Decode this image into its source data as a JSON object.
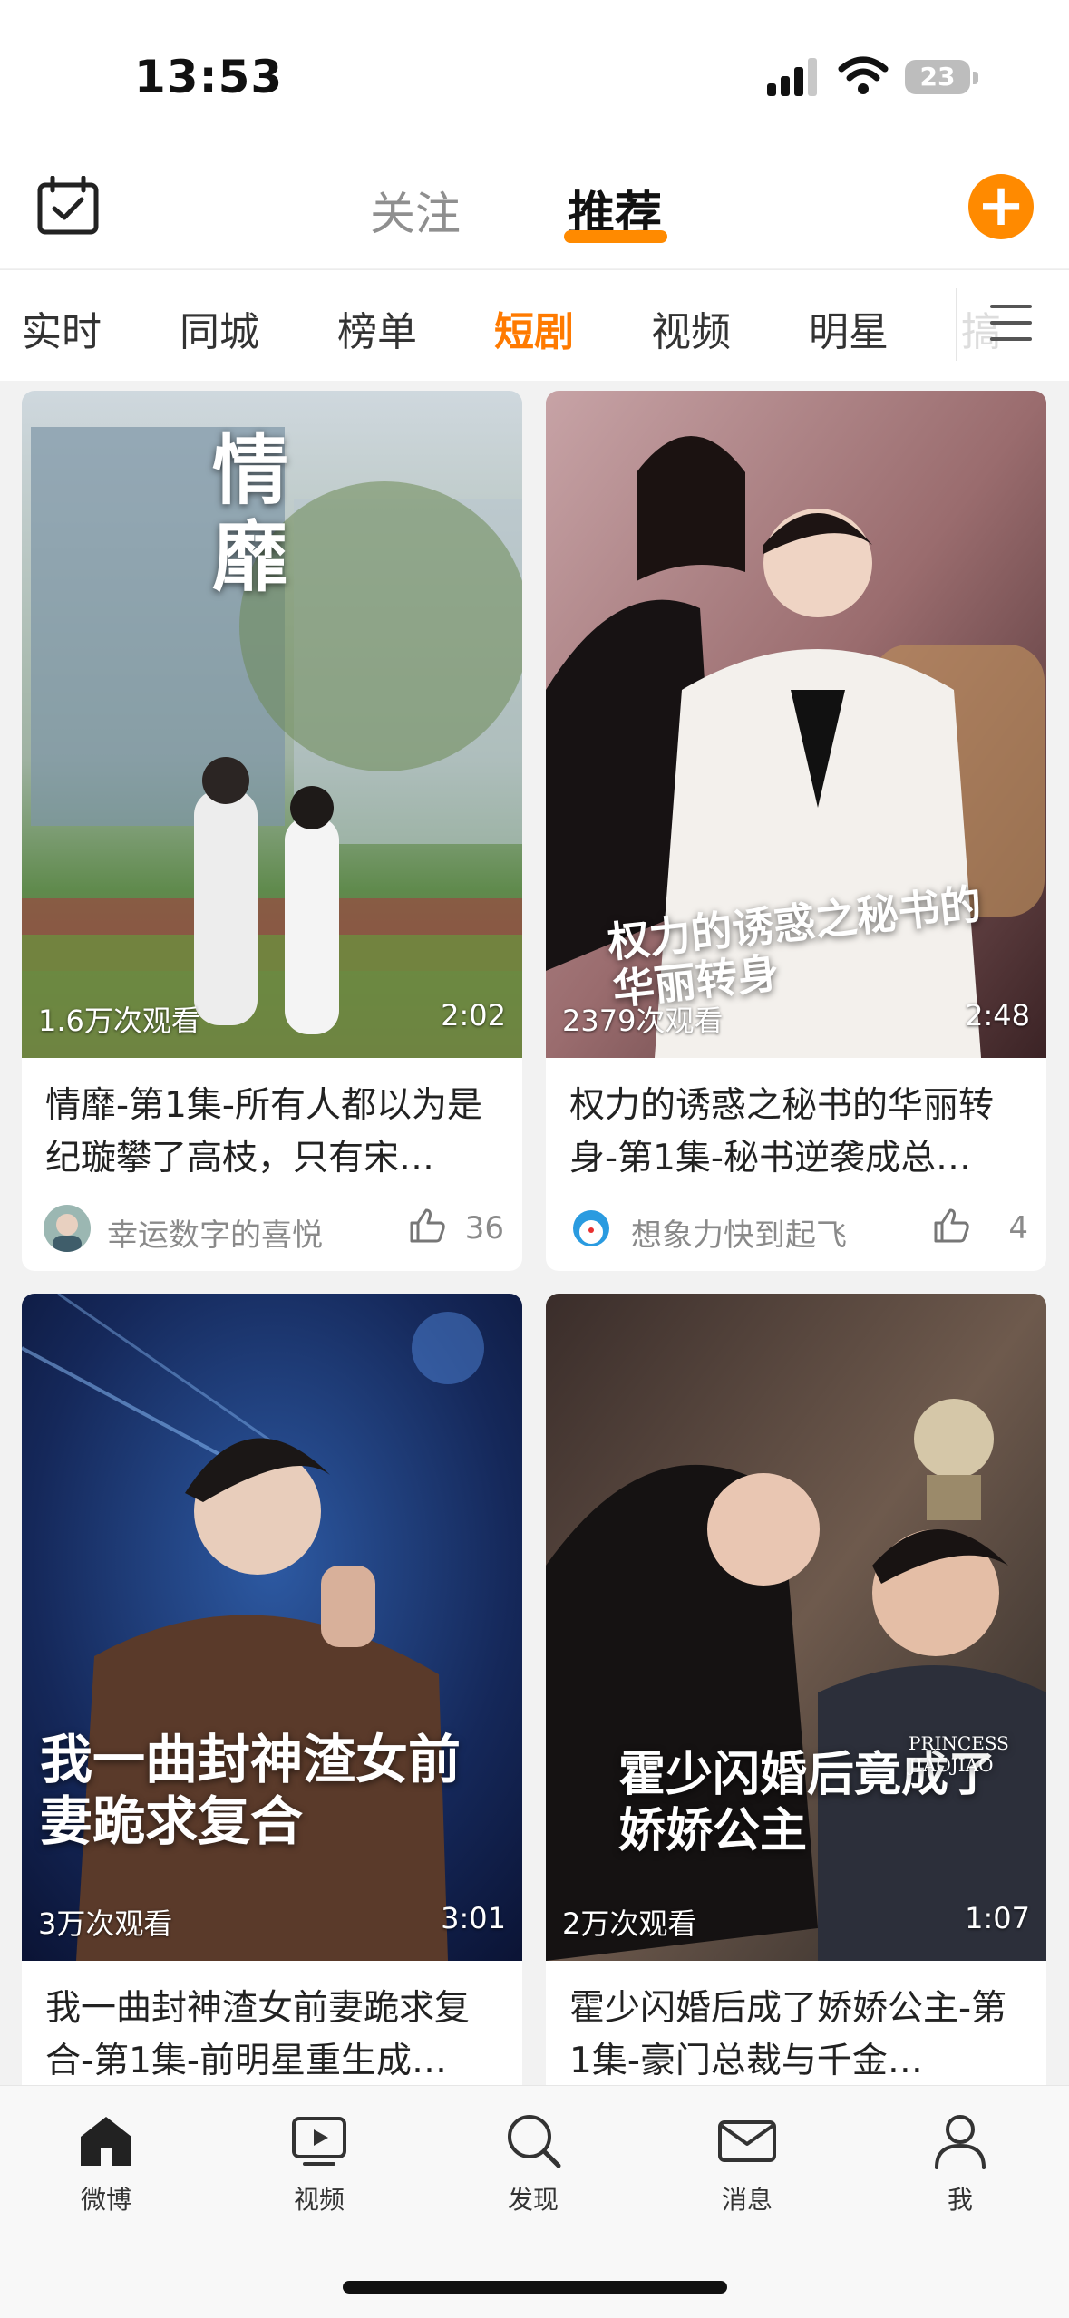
{
  "status_bar": {
    "time": "13:53",
    "battery": "23"
  },
  "header": {
    "tabs": [
      {
        "label": "关注",
        "active": false
      },
      {
        "label": "推荐",
        "active": true
      }
    ],
    "accent_color": "#ff8a00"
  },
  "categories": {
    "items": [
      "实时",
      "同城",
      "榜单",
      "短剧",
      "视频",
      "明星",
      "搞"
    ],
    "active": "短剧"
  },
  "feed": [
    {
      "overlay_title": "情靡",
      "views": "1.6万次观看",
      "duration": "2:02",
      "title": "情靡-第1集-所有人都以为是纪璇攀了高枝，只有宋…",
      "author": "幸运数字的喜悦",
      "likes": "36"
    },
    {
      "overlay_title": "权力的诱惑之秘书的华丽转身",
      "views": "2379次观看",
      "duration": "2:48",
      "title": "权力的诱惑之秘书的华丽转身-第1集-秘书逆袭成总…",
      "author": "想象力快到起飞",
      "likes": "4"
    },
    {
      "overlay_title": "我一曲封神渣女前妻跪求复合",
      "views": "3万次观看",
      "duration": "3:01",
      "title": "我一曲封神渣女前妻跪求复合-第1集-前明星重生成…"
    },
    {
      "overlay_title": "霍少闪婚后竟成了娇娇公主",
      "overlay_subtitle": "PRINCESS JIAOJIAO",
      "views": "2万次观看",
      "duration": "1:07",
      "title": "霍少闪婚后成了娇娇公主-第1集-豪门总裁与千金…"
    }
  ],
  "tabbar": {
    "items": [
      {
        "label": "微博",
        "icon": "home-icon"
      },
      {
        "label": "视频",
        "icon": "video-icon"
      },
      {
        "label": "发现",
        "icon": "search-icon"
      },
      {
        "label": "消息",
        "icon": "mail-icon"
      },
      {
        "label": "我",
        "icon": "profile-icon"
      }
    ]
  }
}
